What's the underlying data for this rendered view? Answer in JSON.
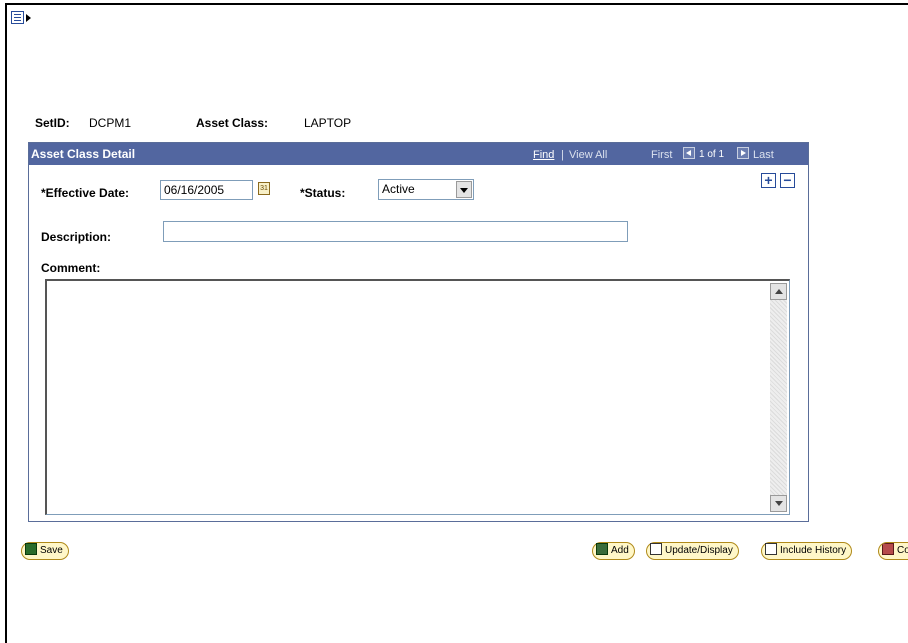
{
  "header": {
    "setid_label": "SetID:",
    "setid_value": "DCPM1",
    "asset_class_label": "Asset Class:",
    "asset_class_value": "LAPTOP"
  },
  "grid": {
    "title": "Asset Class Detail",
    "find": "Find",
    "separator": "|",
    "view_all": "View All",
    "first": "First",
    "count": "1 of 1",
    "last": "Last"
  },
  "form": {
    "effective_date_label": "*Effective Date:",
    "effective_date_value": "06/16/2005",
    "calendar_glyph": "31",
    "status_label": "*Status:",
    "status_value": "Active",
    "description_label": "Description:",
    "description_value": "",
    "comment_label": "Comment:",
    "comment_value": "",
    "add_row": "+",
    "delete_row": "−"
  },
  "buttons": {
    "save": "Save",
    "add": "Add",
    "update_display": "Update/Display",
    "include_history": "Include History",
    "correct_history": "Correct History"
  },
  "icons": {
    "page_menu": "page-menu-icon",
    "calendar": "calendar-icon"
  },
  "colors": {
    "grid_header": "#5266a0",
    "button_fill": "#fff7c8"
  }
}
